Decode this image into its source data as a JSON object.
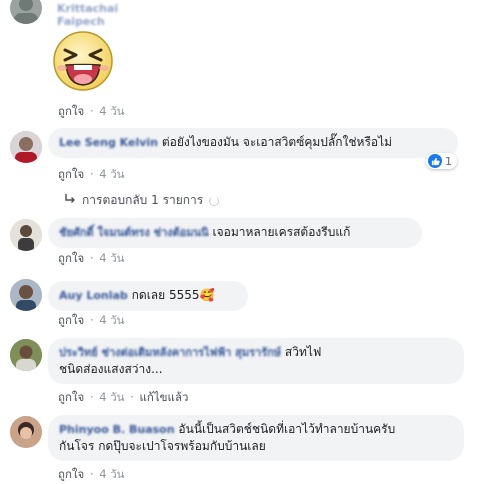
{
  "comments": [
    {
      "author": "Krittachai Faipech",
      "text": "",
      "sticker": "laughing-sticker",
      "actions": {
        "like": "ถูกใจ",
        "dot": "·",
        "time": "4 วัน"
      }
    },
    {
      "author": "Lee Seng Kelvin",
      "text": "ต่อยังไงของมัน จะเอาสวิตซ์คุมปลั๊กใช่หรือไม่",
      "reaction": {
        "icon": "thumbs-up-icon",
        "count": "1"
      },
      "actions": {
        "like": "ถูกใจ",
        "dot": "·",
        "time": "4 วัน"
      },
      "replies": {
        "label": "การตอบกลับ 1 รายการ"
      }
    },
    {
      "author": "ชัยศักดิ์ ใจมนต์ทรง ช่างต้อมนนิ",
      "text": "เจอมาหลายเครสต้องรีบแก้",
      "actions": {
        "like": "ถูกใจ",
        "dot": "·",
        "time": "4 วัน"
      }
    },
    {
      "author": "Auy Lonlab",
      "text": "กดเลย 5555🥰",
      "actions": {
        "like": "ถูกใจ",
        "dot": "·",
        "time": "4 วัน"
      }
    },
    {
      "author": "ประวิทย์ ช่างต่อเติมหลังคาการไฟฟ้า สุมรารักษ์",
      "text_line1": "สวิทไฟ",
      "text_line2": "ชนิดส่องแสงสว่าง...",
      "actions": {
        "like": "ถูกใจ",
        "dot": "·",
        "time": "4 วัน",
        "dot2": "·",
        "edited": "แก้ไขแล้ว"
      }
    },
    {
      "author": "Phinyoo B. Buason",
      "text_line1": "อันนี้เป็นสวิตช์ชนิดที่เอาไว้ทำลายบ้านครับ",
      "text_line2": "กันโจร กดปุ๊บจะเปาโจรพร้อมกับบ้านเลย",
      "actions": {
        "like": "ถูกใจ",
        "dot": "·",
        "time": "4 วัน"
      }
    }
  ],
  "colors": {
    "link": "#385898",
    "bubble": "#f2f3f5",
    "meta": "#90949c",
    "like_blue": "#1877f2"
  }
}
